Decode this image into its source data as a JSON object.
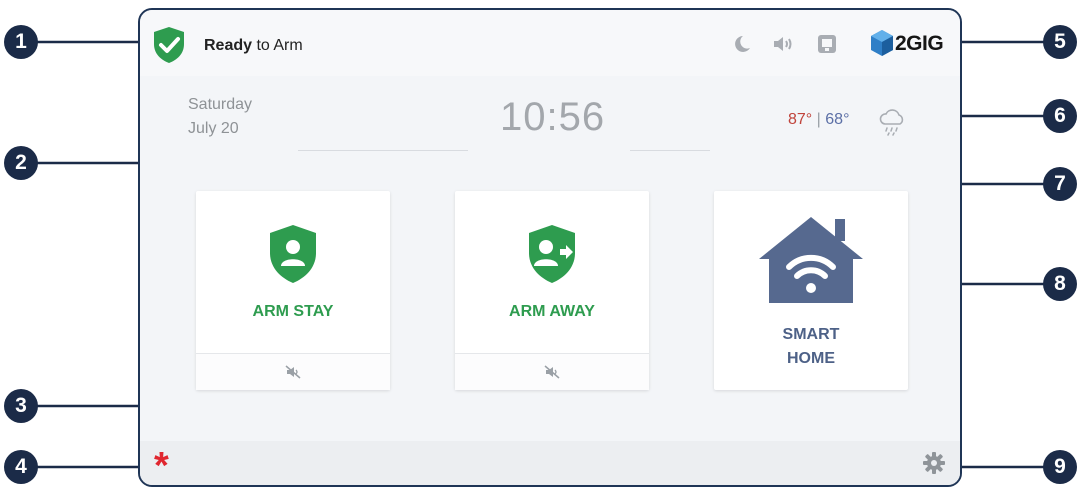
{
  "status": {
    "bold": "Ready",
    "rest": " to Arm"
  },
  "brand": {
    "name": "2GIG"
  },
  "toolbar_icons": [
    "moon-icon",
    "speaker-icon",
    "display-icon"
  ],
  "datetime": {
    "day": "Saturday",
    "date": "July 20",
    "time": "10:56"
  },
  "weather": {
    "high": "87°",
    "separator": "|",
    "low": "68°",
    "icon": "cloud-rain-icon"
  },
  "cards": {
    "arm_stay": {
      "label": "ARM STAY"
    },
    "arm_away": {
      "label": "ARM AWAY"
    },
    "smart_home": {
      "line1": "SMART",
      "line2": "HOME"
    }
  },
  "footer": {
    "emergency_symbol": "*"
  },
  "callouts": [
    "1",
    "2",
    "3",
    "4",
    "5",
    "6",
    "7",
    "8",
    "9"
  ],
  "colors": {
    "accent_green": "#2e9c4f",
    "navy": "#1b2b48",
    "smart_blue": "#56698f",
    "emergency_red": "#e0262f",
    "temp_high": "#c0433b",
    "temp_low": "#5b6fa6"
  }
}
